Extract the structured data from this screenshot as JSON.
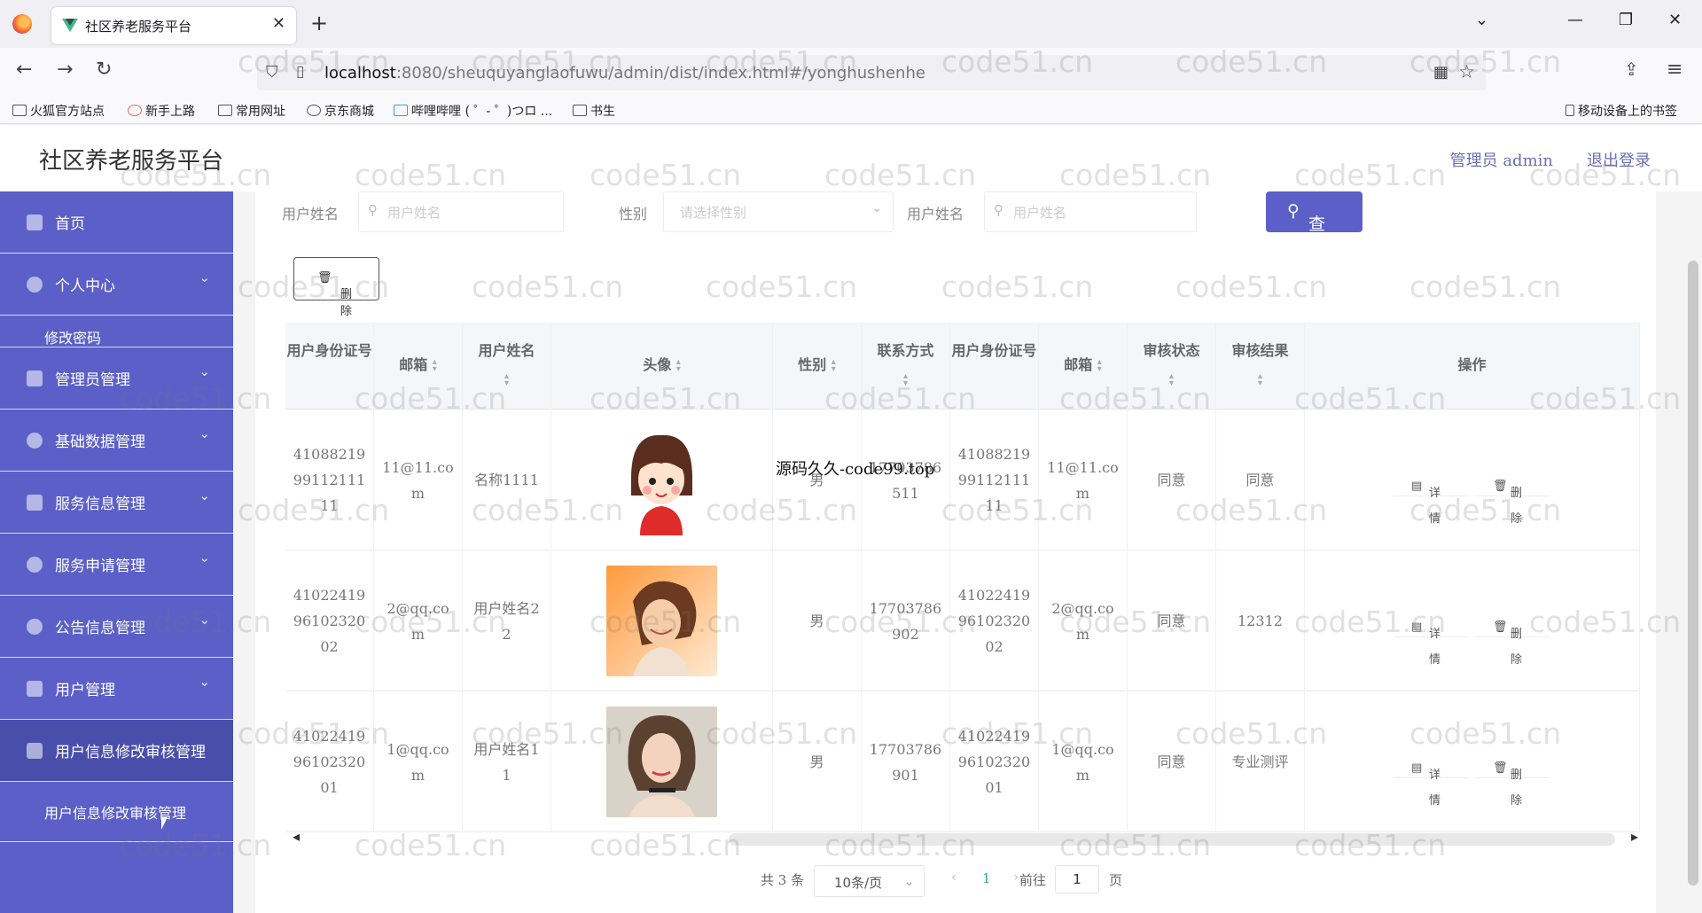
{
  "browser": {
    "tab_title": "社区养老服务平台",
    "url_host": "localhost",
    "url_rest": ":8080/sheuquyanglaofuwu/admin/dist/index.html#/yonghushenhe",
    "bookmarks": [
      "火狐官方站点",
      "新手上路",
      "常用网址",
      "京东商城",
      "哔哩哔哩 ( ゜- ゜)つロ ...",
      "书生"
    ],
    "mobile_bookmarks": "移动设备上的书签"
  },
  "header": {
    "brand": "社区养老服务平台",
    "admin_label": "管理员 admin",
    "logout_label": "退出登录"
  },
  "sidebar": {
    "items": [
      {
        "label": "首页"
      },
      {
        "label": "个人中心"
      },
      {
        "label": "管理员管理"
      },
      {
        "label": "基础数据管理"
      },
      {
        "label": "服务信息管理"
      },
      {
        "label": "服务申请管理"
      },
      {
        "label": "公告信息管理"
      },
      {
        "label": "用户管理"
      },
      {
        "label": "用户信息修改审核管理"
      }
    ],
    "sub_password": "修改密码",
    "sub_audit": "用户信息修改审核管理"
  },
  "filters": {
    "label1": "用户姓名",
    "placeholder1": "用户姓名",
    "label2": "性别",
    "placeholder2": "请选择性别",
    "label3": "用户姓名",
    "placeholder3": "用户姓名",
    "query_button": "查询",
    "delete_button": "删除"
  },
  "table": {
    "headers": [
      "用户身份证号",
      "邮箱",
      "用户姓名",
      "头像",
      "性别",
      "联系方式",
      "用户身份证号",
      "邮箱",
      "审核状态",
      "审核结果",
      "操作"
    ],
    "rows": [
      {
        "id": "410882199911211111",
        "email": "11@11.com",
        "name": "名称1111",
        "gender": "男",
        "phone": "17703786511",
        "id2": "410882199911211111",
        "email2": "11@11.com",
        "status": "同意",
        "result": "同意"
      },
      {
        "id": "410224199610232002",
        "email": "2@qq.com",
        "name": "用户姓名22",
        "gender": "男",
        "phone": "17703786902",
        "id2": "410224199610232002",
        "email2": "2@qq.com",
        "status": "同意",
        "result": "12312"
      },
      {
        "id": "410224199610232001",
        "email": "1@qq.com",
        "name": "用户姓名11",
        "gender": "男",
        "phone": "17703786901",
        "id2": "410224199610232001",
        "email2": "1@qq.com",
        "status": "同意",
        "result": "专业测评"
      }
    ],
    "detail_label": "详情",
    "delete_label": "删除"
  },
  "pagination": {
    "total": "共 3 条",
    "page_size": "10条/页",
    "current": "1",
    "goto_prefix": "前往",
    "goto_value": "1",
    "goto_suffix": "页"
  },
  "overlay_text": "源码久久-code99.top",
  "watermark": "code51.cn",
  "colors": {
    "primary": "#5b5fc7",
    "active": "#4a4eab"
  }
}
